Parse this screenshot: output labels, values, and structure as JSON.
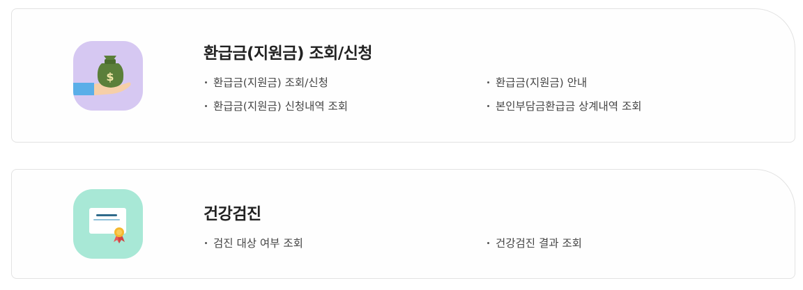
{
  "sections": [
    {
      "title": "환급금(지원금) 조회/신청",
      "icon": "money-bag-hand-icon",
      "icon_bg": "#d6c8f2",
      "links": [
        "환급금(지원금) 조회/신청",
        "환급금(지원금) 안내",
        "환급금(지원금) 신청내역 조회",
        "본인부담금환급금 상계내역 조회"
      ]
    },
    {
      "title": "건강검진",
      "icon": "certificate-icon",
      "icon_bg": "#a8e8d6",
      "links": [
        "검진 대상 여부 조회",
        "건강검진 결과 조회"
      ]
    }
  ]
}
